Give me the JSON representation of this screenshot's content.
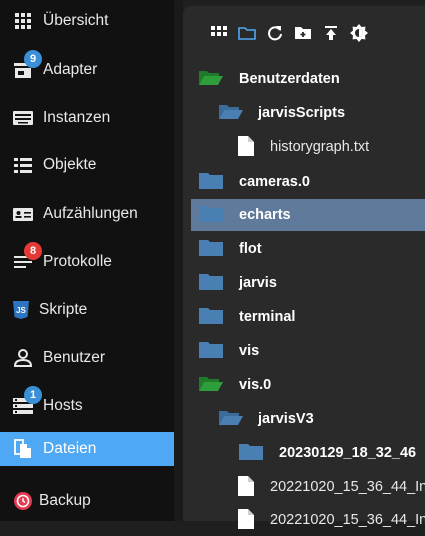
{
  "sidebar": {
    "items": [
      {
        "label": "Übersicht",
        "icon": "grid-icon"
      },
      {
        "label": "Adapter",
        "icon": "store-icon",
        "badge": "9"
      },
      {
        "label": "Instanzen",
        "icon": "keyboard-icon"
      },
      {
        "label": "Objekte",
        "icon": "list-icon"
      },
      {
        "label": "Aufzählungen",
        "icon": "contact-card-icon"
      },
      {
        "label": "Protokolle",
        "icon": "lines-icon",
        "badge": "8"
      },
      {
        "label": "Skripte",
        "icon": "js-icon"
      },
      {
        "label": "Benutzer",
        "icon": "person-icon"
      },
      {
        "label": "Hosts",
        "icon": "server-icon",
        "badge": "1"
      },
      {
        "label": "Dateien",
        "icon": "files-icon",
        "active": true
      },
      {
        "label": "Backup",
        "icon": "backup-icon"
      }
    ]
  },
  "toolbar": {
    "buttons": [
      "tile-view-icon",
      "folder-view-icon",
      "refresh-icon",
      "new-folder-icon",
      "upload-icon",
      "brightness-icon"
    ]
  },
  "files": {
    "rows": [
      {
        "name": "Benutzerdaten",
        "type": "folder-open-green"
      },
      {
        "name": "jarvisScripts",
        "type": "folder-open-blue"
      },
      {
        "name": "historygraph.txt",
        "type": "file"
      },
      {
        "name": "cameras.0",
        "type": "folder"
      },
      {
        "name": "echarts",
        "type": "folder",
        "selected": true
      },
      {
        "name": "flot",
        "type": "folder"
      },
      {
        "name": "jarvis",
        "type": "folder"
      },
      {
        "name": "terminal",
        "type": "folder"
      },
      {
        "name": "vis",
        "type": "folder"
      },
      {
        "name": "vis.0",
        "type": "folder-open-green"
      },
      {
        "name": "jarvisV3",
        "type": "folder-open-blue"
      },
      {
        "name": "20230129_18_32_46",
        "type": "folder"
      },
      {
        "name": "20221020_15_36_44_In",
        "type": "file"
      },
      {
        "name": "20221020_15_36_44_In",
        "type": "file"
      }
    ]
  },
  "colors": {
    "accent": "#4fa8f3",
    "folder": "#4a7fb3",
    "folder_open_green": "#2e9e3a",
    "selected_row": "#5f7a9a"
  }
}
